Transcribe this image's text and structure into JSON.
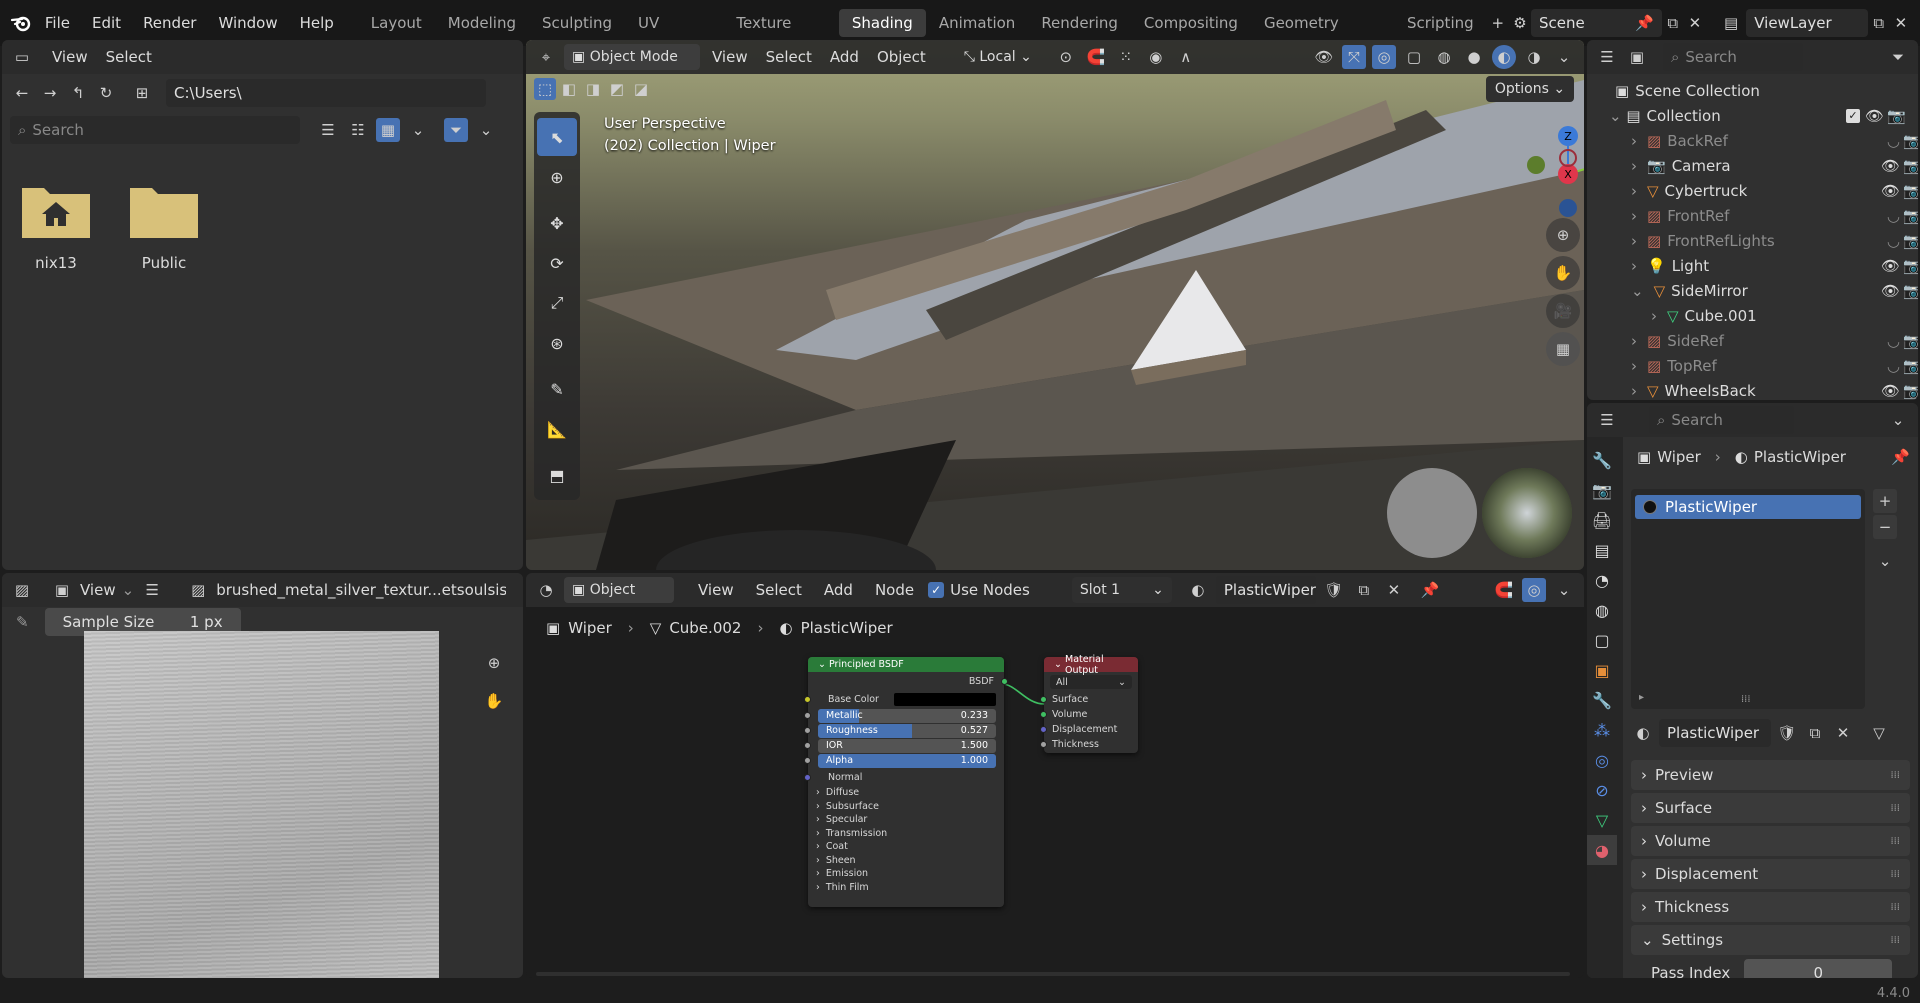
{
  "menus": [
    "File",
    "Edit",
    "Render",
    "Window",
    "Help"
  ],
  "workspaces": [
    "Layout",
    "Modeling",
    "Sculpting",
    "UV Editing",
    "Texture Paint",
    "Shading",
    "Animation",
    "Rendering",
    "Compositing",
    "Geometry Nodes",
    "Scripting"
  ],
  "active_workspace": "Shading",
  "scene_name": "Scene",
  "view_layer": "ViewLayer",
  "file_browser": {
    "menus": [
      "View",
      "Select"
    ],
    "path": "C:\\Users\\",
    "search_placeholder": "Search",
    "items": [
      {
        "label": "nix13",
        "icon": "home-folder-icon"
      },
      {
        "label": "Public",
        "icon": "folder-icon"
      }
    ]
  },
  "viewport": {
    "mode": "Object Mode",
    "menus": [
      "View",
      "Select",
      "Add",
      "Object"
    ],
    "orientation": "Local",
    "options_label": "Options",
    "overlay_line1": "User Perspective",
    "overlay_line2": "(202) Collection | Wiper",
    "gizmo": {
      "z": "Z",
      "y": "Y",
      "x": "X"
    }
  },
  "outliner": {
    "search_placeholder": "Search",
    "scene_collection": "Scene Collection",
    "collection": "Collection",
    "items": [
      {
        "name": "BackRef",
        "muted": true,
        "icon": "image-icon"
      },
      {
        "name": "Camera",
        "muted": false,
        "icon": "camera-icon"
      },
      {
        "name": "Cybertruck",
        "muted": false,
        "icon": "mesh-icon"
      },
      {
        "name": "FrontRef",
        "muted": true,
        "icon": "image-icon"
      },
      {
        "name": "FrontRefLights",
        "muted": true,
        "icon": "image-icon"
      },
      {
        "name": "Light",
        "muted": false,
        "icon": "light-icon"
      },
      {
        "name": "SideMirror",
        "muted": false,
        "icon": "mesh-icon"
      },
      {
        "name": "Cube.001",
        "muted": false,
        "icon": "mesh-data-icon",
        "child": true
      },
      {
        "name": "SideRef",
        "muted": true,
        "icon": "image-icon"
      },
      {
        "name": "TopRef",
        "muted": true,
        "icon": "image-icon"
      },
      {
        "name": "WheelsBack",
        "muted": false,
        "icon": "mesh-icon"
      }
    ]
  },
  "image_editor": {
    "view_menu": "View",
    "image_name": "brushed_metal_silver_textur...etsoulsister_c",
    "sample_label": "Sample Size",
    "sample_value": "1 px"
  },
  "node_editor": {
    "object_label": "Object",
    "menus": [
      "View",
      "Select",
      "Add",
      "Node"
    ],
    "use_nodes_label": "Use Nodes",
    "slot": "Slot 1",
    "material": "PlasticWiper",
    "breadcrumb": [
      "Wiper",
      "Cube.002",
      "PlasticWiper"
    ],
    "bsdf": {
      "title": "Principled BSDF",
      "output": "BSDF",
      "base_color": "Base Color",
      "fields": [
        {
          "label": "Metallic",
          "value": "0.233",
          "fraction": 0.233
        },
        {
          "label": "Roughness",
          "value": "0.527",
          "fraction": 0.527
        },
        {
          "label": "IOR",
          "value": "1.500",
          "fraction": 0
        },
        {
          "label": "Alpha",
          "value": "1.000",
          "fraction": 1
        }
      ],
      "normal": "Normal",
      "panels": [
        "Diffuse",
        "Subsurface",
        "Specular",
        "Transmission",
        "Coat",
        "Sheen",
        "Emission",
        "Thin Film"
      ]
    },
    "output": {
      "title": "Material Output",
      "target": "All",
      "sockets": [
        "Surface",
        "Volume",
        "Displacement",
        "Thickness"
      ]
    }
  },
  "properties": {
    "search_placeholder": "Search",
    "object": "Wiper",
    "material": "PlasticWiper",
    "slot_item": "PlasticWiper",
    "material_field": "PlasticWiper",
    "sections": [
      "Preview",
      "Surface",
      "Volume",
      "Displacement",
      "Thickness",
      "Settings"
    ],
    "pass_index_label": "Pass Index",
    "pass_index_value": "0"
  },
  "version": "4.4.0"
}
